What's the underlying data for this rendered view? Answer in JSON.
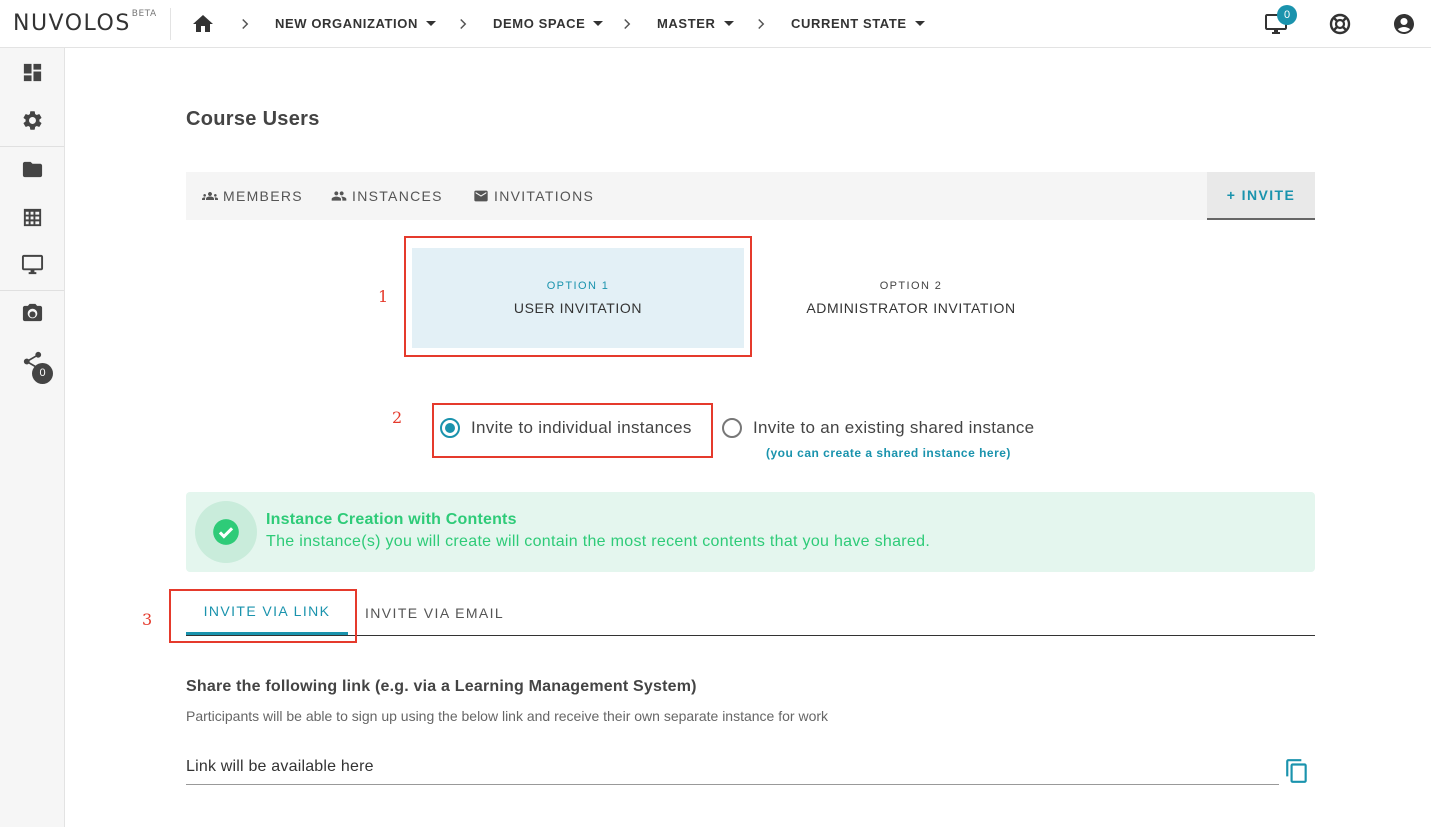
{
  "app": {
    "logo": "NUVOLOS",
    "logo_badge": "BETA"
  },
  "breadcrumb": {
    "items": [
      {
        "label": "NEW ORGANIZATION"
      },
      {
        "label": "DEMO SPACE"
      },
      {
        "label": "MASTER"
      },
      {
        "label": "CURRENT STATE"
      }
    ]
  },
  "topbar": {
    "notification_count": "0",
    "icons": [
      "monitor-icon",
      "help-lifebuoy-icon",
      "account-icon"
    ]
  },
  "sidebar": {
    "icons": [
      "dashboard-icon",
      "settings-icon",
      "folder-icon",
      "table-icon",
      "monitor-icon",
      "camera-icon",
      "share-icon"
    ],
    "share_count": "0"
  },
  "page": {
    "title": "Course Users"
  },
  "tabs": {
    "members": "MEMBERS",
    "instances": "INSTANCES",
    "invitations": "INVITATIONS",
    "invite": "+ INVITE"
  },
  "options": {
    "option1_small": "OPTION 1",
    "option1_label": "USER INVITATION",
    "option2_small": "OPTION 2",
    "option2_label": "ADMINISTRATOR INVITATION"
  },
  "radio": {
    "individual": "Invite to individual instances",
    "shared": "Invite to an existing shared instance",
    "shared_link": "(you can create a shared instance here)",
    "selected": "individual"
  },
  "alert": {
    "title": "Instance Creation with Contents",
    "text": "The instance(s) you will create will contain the most recent contents that you have shared."
  },
  "subtabs": {
    "link": "INVITE VIA LINK",
    "email": "INVITE VIA EMAIL"
  },
  "share": {
    "title": "Share the following link (e.g. via a Learning Management System)",
    "description": "Participants will be able to sign up using the below link and receive their own separate instance for work",
    "link_value": "Link will be available here"
  },
  "annotations": {
    "marker1": "1",
    "marker2": "2",
    "marker3": "3",
    "color": "#e53a2c"
  },
  "colors": {
    "accent": "#1a93ad",
    "success": "#2ecb78",
    "success_bg": "#e4f6ee"
  }
}
